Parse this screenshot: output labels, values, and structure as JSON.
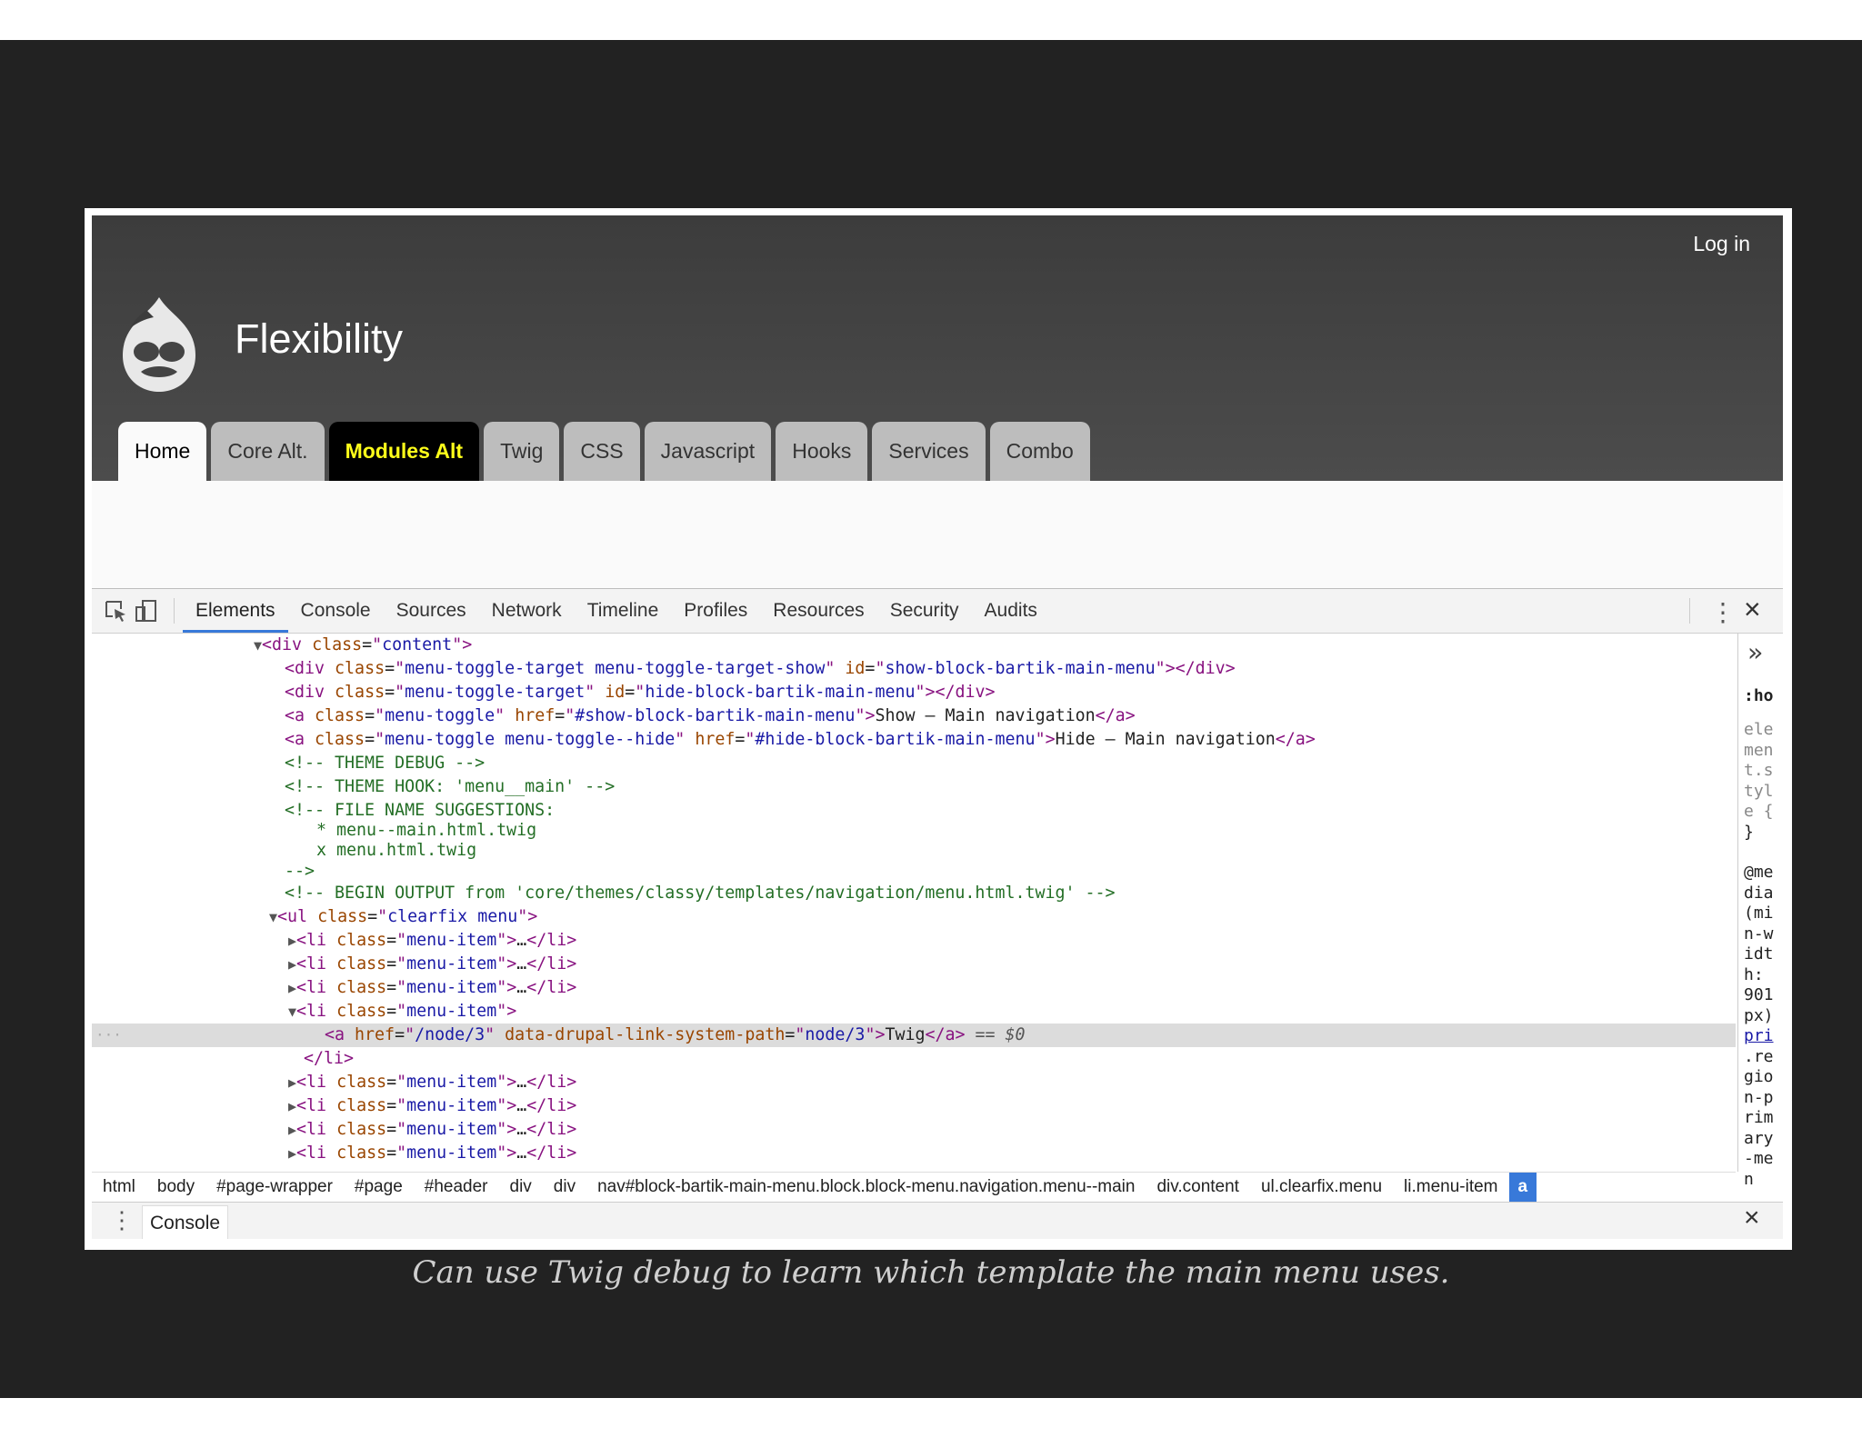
{
  "site": {
    "login_label": "Log in",
    "site_name": "Flexibility",
    "tabs": [
      "Home",
      "Core Alt.",
      "Modules Alt",
      "Twig",
      "CSS",
      "Javascript",
      "Hooks",
      "Services",
      "Combo"
    ],
    "active_tab": "Home",
    "highlight_tab_color": "#ffff1a"
  },
  "devtools": {
    "tabs": [
      "Elements",
      "Console",
      "Sources",
      "Network",
      "Timeline",
      "Profiles",
      "Resources",
      "Security",
      "Audits"
    ],
    "active_tab": "Elements",
    "accent_color": "#3879d9",
    "side_panel": {
      "hov_label": ":ho",
      "selector": "element.style {",
      "close_brace": "}",
      "media_query": "@media (min-width: 901px)",
      "source_link": "pri",
      "region_selector": ".region-primary-men"
    },
    "breadcrumbs": [
      "html",
      "body",
      "#page-wrapper",
      "#page",
      "#header",
      "div",
      "div",
      "nav#block-bartik-main-menu.block.block-menu.navigation.menu--main",
      "div.content",
      "ul.clearfix.menu",
      "li.menu-item",
      "a"
    ],
    "drawer_tab": "Console"
  },
  "code": {
    "div_content": "content",
    "toggle_target_show_class": "menu-toggle-target menu-toggle-target-show",
    "toggle_target_show_id": "show-block-bartik-main-menu",
    "toggle_target_class": "menu-toggle-target",
    "toggle_target_hide_id": "hide-block-bartik-main-menu",
    "toggle_class": "menu-toggle",
    "toggle_href": "#show-block-bartik-main-menu",
    "toggle_text": "Show – Main navigation",
    "toggle_hide_class": "menu-toggle menu-toggle--hide",
    "toggle_hide_href": "#hide-block-bartik-main-menu",
    "toggle_hide_text": "Hide – Main navigation",
    "comment_theme_debug": "<!-- THEME DEBUG -->",
    "comment_theme_hook": "<!-- THEME HOOK: 'menu__main' -->",
    "comment_suggestions": "<!-- FILE NAME SUGGESTIONS:",
    "suggestion_1": "* menu--main.html.twig",
    "suggestion_2": "x menu.html.twig",
    "comment_end": "-->",
    "comment_begin_output": "<!-- BEGIN OUTPUT from 'core/themes/classy/templates/navigation/menu.html.twig' -->",
    "ul_class": "clearfix menu",
    "li_class": "menu-item",
    "link_href": "/node/3",
    "link_attr": "data-drupal-link-system-path",
    "link_path": "node/3",
    "link_text": "Twig",
    "selected_marker": "== $0"
  },
  "caption": "Can use Twig debug to learn which template the main menu uses."
}
